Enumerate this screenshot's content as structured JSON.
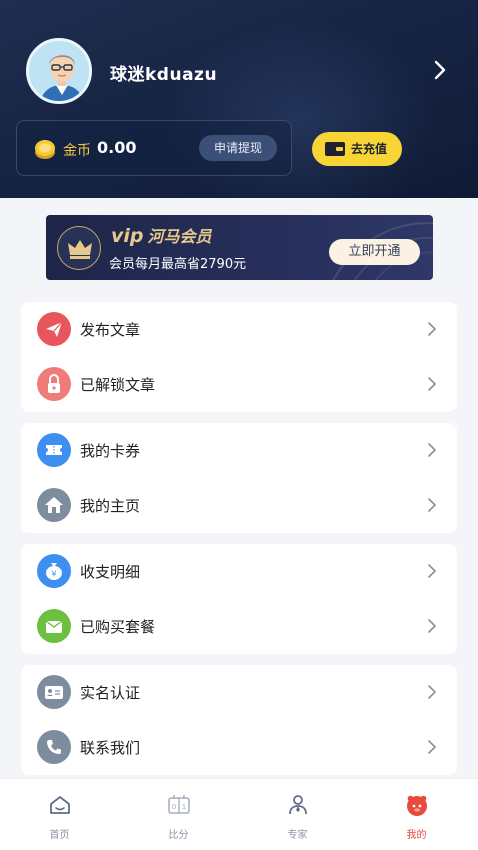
{
  "profile": {
    "username": "球迷kduazu"
  },
  "wallet": {
    "coin_label": "金币",
    "coin_value": "0.00",
    "withdraw_label": "申请提现",
    "recharge_label": "去充值"
  },
  "vip": {
    "badge": "vip",
    "title": "河马会员",
    "subtitle": "会员每月最高省2790元",
    "button": "立即开通"
  },
  "menu_groups": [
    [
      {
        "label": "发布文章",
        "icon": "send-icon",
        "color": "#e8555a"
      },
      {
        "label": "已解锁文章",
        "icon": "unlock-icon",
        "color": "#f07b7b"
      }
    ],
    [
      {
        "label": "我的卡券",
        "icon": "ticket-icon",
        "color": "#3d8ff0"
      },
      {
        "label": "我的主页",
        "icon": "home-icon",
        "color": "#7e8d9e"
      }
    ],
    [
      {
        "label": "收支明细",
        "icon": "money-bag-icon",
        "color": "#3d8ff0"
      },
      {
        "label": "已购买套餐",
        "icon": "package-icon",
        "color": "#6cbf3f"
      }
    ],
    [
      {
        "label": "实名认证",
        "icon": "id-card-icon",
        "color": "#7e8d9e"
      },
      {
        "label": "联系我们",
        "icon": "phone-icon",
        "color": "#7e8d9e"
      }
    ]
  ],
  "tabbar": [
    {
      "label": "首页",
      "icon": "home-tab-icon",
      "active": false
    },
    {
      "label": "比分",
      "icon": "scoreboard-icon",
      "active": false
    },
    {
      "label": "专家",
      "icon": "expert-icon",
      "active": false
    },
    {
      "label": "我的",
      "icon": "profile-tab-icon",
      "active": true
    }
  ],
  "colors": {
    "header_bg": "#172444",
    "accent_yellow": "#f7d534",
    "active_tab": "#e84a3c",
    "vip_gold": "#e8c98c"
  }
}
